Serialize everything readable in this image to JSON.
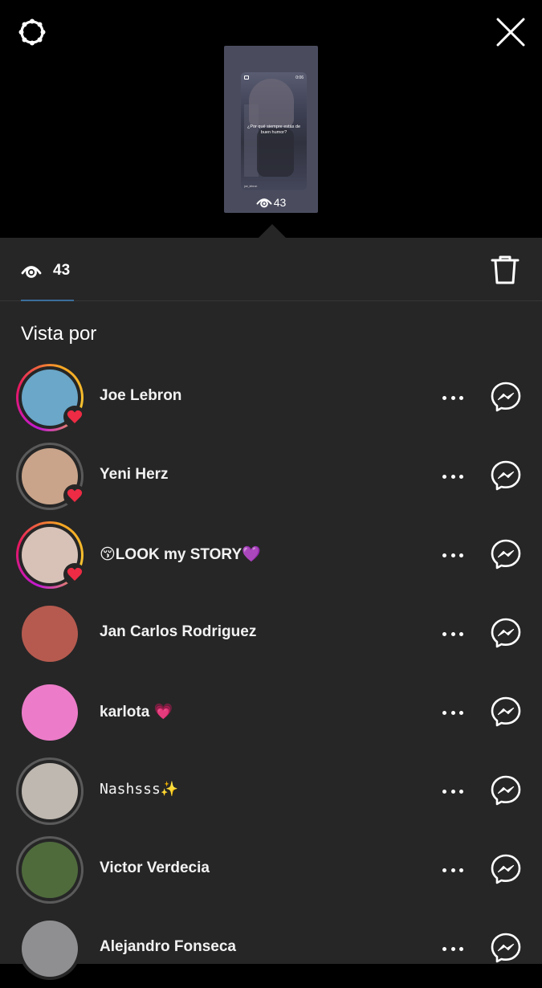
{
  "story_preview": {
    "caption": "¿Por qué siempre estás de buen humor?",
    "time": "0:06",
    "username": "joe_lebron",
    "views": "43"
  },
  "stats": {
    "views_count": "43"
  },
  "section_title": "Vista por",
  "viewers": [
    {
      "name": "Joe Lebron",
      "ring": "story",
      "liked": true,
      "avatar_color": "#6aa7c9"
    },
    {
      "name": "Yeni Herz",
      "ring": "seen",
      "liked": true,
      "avatar_color": "#c9a48a"
    },
    {
      "name": "😚LOOK my STORY💜",
      "ring": "story",
      "liked": true,
      "avatar_color": "#d8c2b8"
    },
    {
      "name": "Jan Carlos Rodriguez",
      "ring": "none",
      "liked": false,
      "avatar_color": "#b65a4f"
    },
    {
      "name": "karlota 💗",
      "ring": "none",
      "liked": false,
      "avatar_color": "#ec7cc9"
    },
    {
      "name": "Nashsss✨",
      "ring": "seen",
      "liked": false,
      "avatar_color": "#bfb8b0"
    },
    {
      "name": "Victor Verdecia",
      "ring": "seen",
      "liked": false,
      "avatar_color": "#4f6b3c"
    },
    {
      "name": "Alejandro Fonseca",
      "ring": "none",
      "liked": false,
      "avatar_color": "#8f8f92"
    }
  ],
  "colors": {
    "sheet_bg": "#262626",
    "heart": "#ed2b44",
    "tab_underline": "#3a6f9b"
  },
  "icons": [
    "settings-icon",
    "close-icon",
    "eye-icon",
    "trash-icon",
    "heart-icon",
    "more-icon",
    "messenger-icon"
  ]
}
